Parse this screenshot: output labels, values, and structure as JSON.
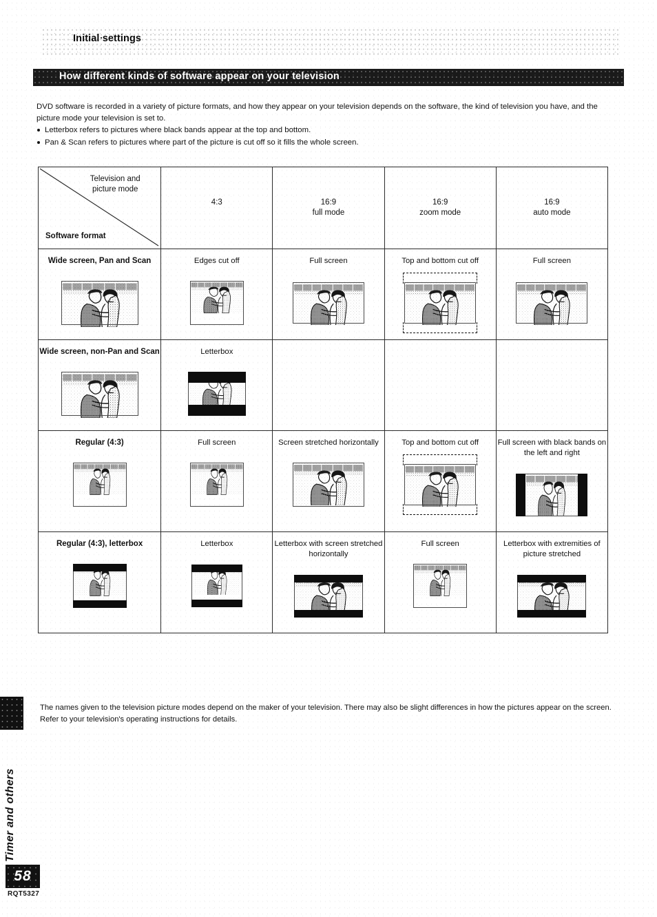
{
  "running_head": {
    "title": "Initial settings"
  },
  "banner": {
    "title": "How different kinds of software appear on your television"
  },
  "intro": {
    "paragraph": "DVD software is recorded in a variety of picture formats, and how they appear on your television depends on the software, the kind of television you have, and the picture mode your television is set to.",
    "bullets": [
      "Letterbox refers to pictures where black bands appear at the top and bottom.",
      "Pan & Scan refers to pictures where part of the picture is cut off so it fills the whole screen."
    ]
  },
  "table": {
    "corner": {
      "top_label": "Television and picture mode",
      "bottom_label": "Software format"
    },
    "columns": [
      {
        "line1": "4:3",
        "line2": ""
      },
      {
        "line1": "16:9",
        "line2": "full mode"
      },
      {
        "line1": "16:9",
        "line2": "zoom mode"
      },
      {
        "line1": "16:9",
        "line2": "auto mode"
      }
    ],
    "rows": [
      {
        "label": "Wide screen, Pan and Scan",
        "source_thumb": "widescreen",
        "cells": [
          {
            "caption": "Edges cut off",
            "thumb": "widescreen-cropped"
          },
          {
            "caption": "Full screen",
            "thumb": "widescreen"
          },
          {
            "caption": "Top and bottom cut off",
            "thumb": "widescreen-zoom-crop"
          },
          {
            "caption": "Full screen",
            "thumb": "widescreen"
          }
        ]
      },
      {
        "label": "Wide screen, non-Pan and Scan",
        "source_thumb": "widescreen",
        "cells": [
          {
            "caption": "Letterbox",
            "thumb": "letterbox"
          },
          {
            "caption": "",
            "thumb": ""
          },
          {
            "caption": "",
            "thumb": ""
          },
          {
            "caption": "",
            "thumb": ""
          }
        ]
      },
      {
        "label": "Regular (4:3)",
        "source_thumb": "regular43",
        "cells": [
          {
            "caption": "Full screen",
            "thumb": "regular43"
          },
          {
            "caption": "Screen stretched horizontally",
            "thumb": "regular43-stretched"
          },
          {
            "caption": "Top and bottom cut off",
            "thumb": "regular43-zoom-crop"
          },
          {
            "caption": "Full screen with black bands on the left and right",
            "thumb": "regular43-pillarbox"
          }
        ]
      },
      {
        "label": "Regular (4:3), letterbox",
        "source_thumb": "letterbox-43",
        "cells": [
          {
            "caption": "Letterbox",
            "thumb": "letterbox-43"
          },
          {
            "caption": "Letterbox with screen stretched horizontally",
            "thumb": "letterbox-stretched"
          },
          {
            "caption": "Full screen",
            "thumb": "regular43"
          },
          {
            "caption": "Letterbox with extremities of picture stretched",
            "thumb": "letterbox-extremities"
          }
        ]
      }
    ]
  },
  "footer_note": "The names given to the television picture modes depend on the maker of your television. There may also be slight differences in how the pictures appear on the screen. Refer to your television's operating instructions for details.",
  "side_tab": {
    "label": "Timer and others"
  },
  "page": {
    "number": "58",
    "model_code": "RQT5327"
  }
}
